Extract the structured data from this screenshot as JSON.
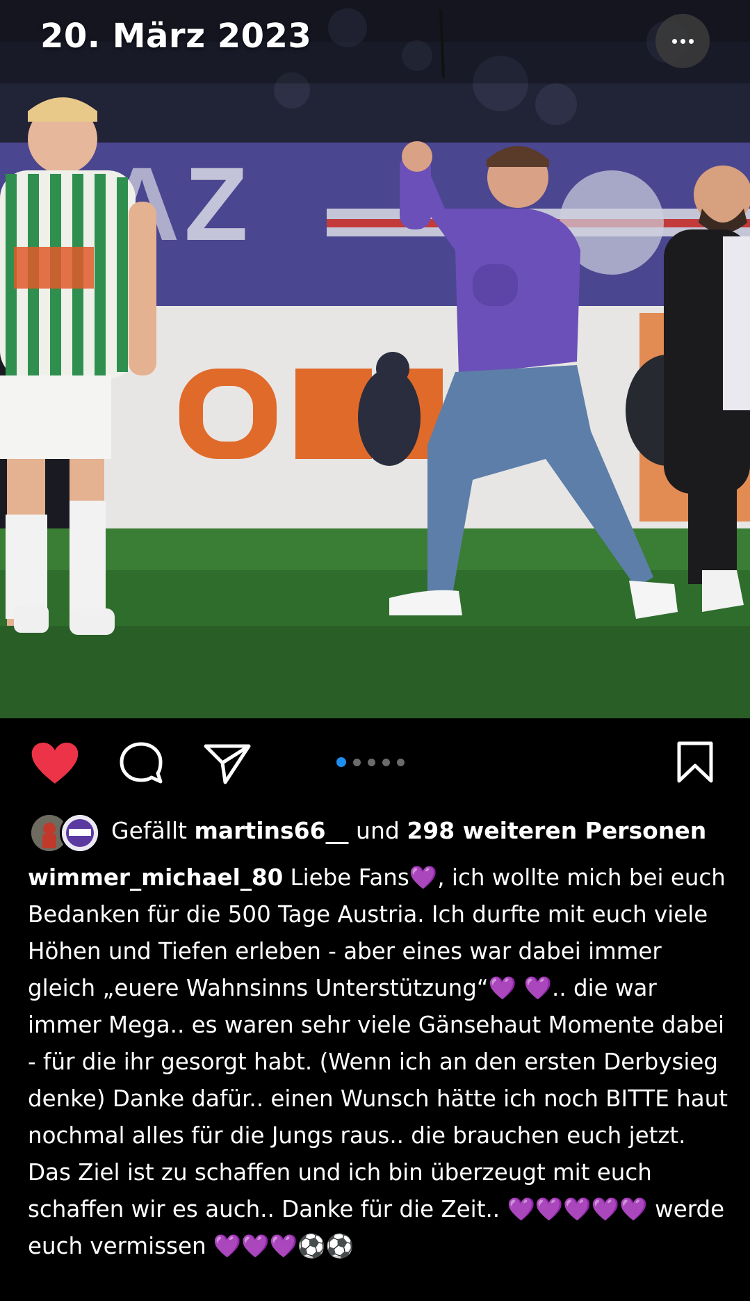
{
  "post": {
    "date": "20. März 2023"
  },
  "carousel": {
    "count": 5,
    "active": 0
  },
  "likes": {
    "prefix": "Gefällt ",
    "user": "martins66__",
    "middle": " und ",
    "count_text": "298 weiteren Personen"
  },
  "caption": {
    "username": "wimmer_michael_80",
    "part1": " Liebe Fans",
    "part2": ", ich wollte mich bei euch Bedanken für die 500 Tage Austria. Ich durfte mit euch viele Höhen und Tiefen erleben - aber eines war dabei immer gleich „euere Wahnsinns Unterstützung“",
    "part3": ".. die war immer Mega.. es waren sehr  viele Gänsehaut Momente dabei - für die ihr gesorgt habt. (Wenn ich an den ersten Derbysieg denke) Danke dafür.. einen Wunsch hätte ich noch BITTE haut nochmal alles für die Jungs raus.. die brauchen euch jetzt. Das Ziel ist zu schaffen und ich bin überzeugt mit euch schaffen wir es auch.. Danke für die Zeit.. ",
    "part4": " werde euch vermissen",
    "heart": "💜",
    "ball": "⚽",
    "hearts5": "💜💜💜💜💜",
    "hearts3": "💜💜💜",
    "balls2": "⚽⚽"
  },
  "colors": {
    "like": "#ed3347",
    "active_dot": "#1f8ef1",
    "heart_purple": "#a64be6"
  },
  "icons": {
    "like": "heart-filled-icon",
    "comment": "comment-bubble-icon",
    "share": "paper-plane-icon",
    "save": "bookmark-icon",
    "more": "ellipsis-icon"
  }
}
